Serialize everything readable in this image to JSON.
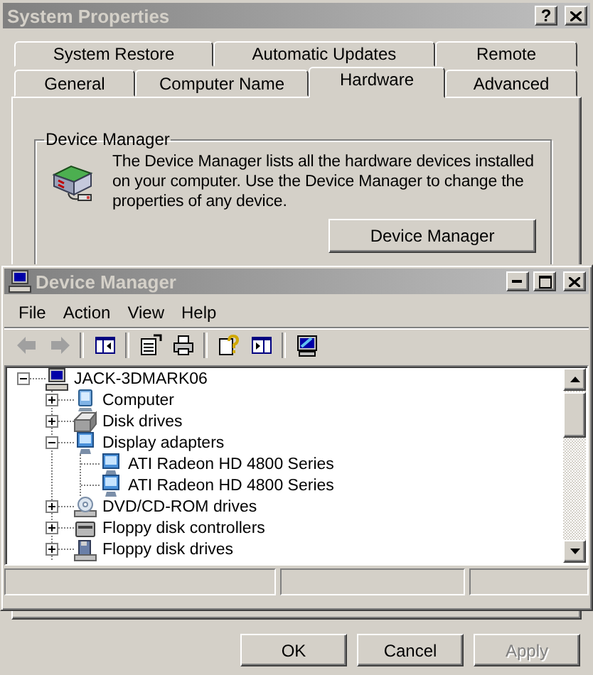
{
  "system_properties": {
    "title": "System Properties",
    "help_button": "?",
    "tabs_row_1": [
      {
        "label": "System Restore",
        "selected": false
      },
      {
        "label": "Automatic Updates",
        "selected": false
      },
      {
        "label": "Remote",
        "selected": false
      }
    ],
    "tabs_row_2": [
      {
        "label": "General",
        "selected": false
      },
      {
        "label": "Computer Name",
        "selected": false
      },
      {
        "label": "Hardware",
        "selected": true
      },
      {
        "label": "Advanced",
        "selected": false
      }
    ],
    "group": {
      "title": "Device Manager",
      "description": "The Device Manager lists all the hardware devices installed on your computer. Use the Device Manager to change the properties of any device.",
      "button": "Device Manager"
    },
    "buttons": [
      {
        "label": "OK",
        "disabled": false
      },
      {
        "label": "Cancel",
        "disabled": false
      },
      {
        "label": "Apply",
        "disabled": true
      }
    ]
  },
  "device_manager": {
    "title": "Device Manager",
    "menu": [
      "File",
      "Action",
      "View",
      "Help"
    ],
    "toolbar": [
      [
        {
          "kind": "back",
          "disabled": true
        },
        {
          "kind": "forward",
          "disabled": true
        }
      ],
      [
        {
          "kind": "console-tree",
          "disabled": false
        }
      ],
      [
        {
          "kind": "properties",
          "disabled": false
        },
        {
          "kind": "print",
          "disabled": false
        }
      ],
      [
        {
          "kind": "help",
          "disabled": false
        },
        {
          "kind": "action-pane",
          "disabled": false
        }
      ],
      [
        {
          "kind": "scan",
          "disabled": false
        }
      ]
    ],
    "tree": [
      {
        "label": "JACK-3DMARK06",
        "kind": "computer",
        "expanded": true,
        "children": [
          {
            "label": "Computer",
            "kind": "computer-unit",
            "expanded": false
          },
          {
            "label": "Disk drives",
            "kind": "disk",
            "expanded": false
          },
          {
            "label": "Display adapters",
            "kind": "display",
            "expanded": true,
            "children": [
              {
                "label": "ATI Radeon HD 4800 Series",
                "kind": "display"
              },
              {
                "label": "ATI Radeon HD 4800 Series",
                "kind": "display"
              }
            ]
          },
          {
            "label": "DVD/CD-ROM drives",
            "kind": "dvd",
            "expanded": false
          },
          {
            "label": "Floppy disk controllers",
            "kind": "floppy-controller",
            "expanded": false
          },
          {
            "label": "Floppy disk drives",
            "kind": "floppy-drive",
            "expanded": false
          }
        ]
      }
    ]
  }
}
